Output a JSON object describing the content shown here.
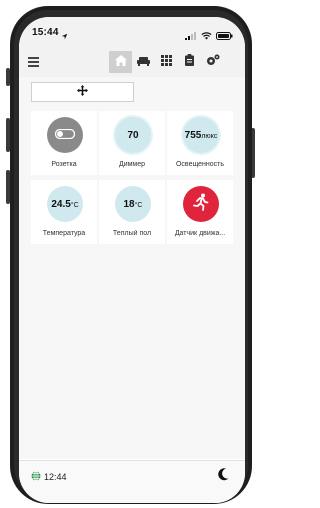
{
  "status_bar": {
    "time": "15:44"
  },
  "toolbar": {
    "icons": [
      "menu-icon",
      "home-icon",
      "sofa-icon",
      "grid-icon",
      "clipboard-icon",
      "settings-icon"
    ]
  },
  "move_box": {
    "icon": "move-arrows-icon"
  },
  "tiles": [
    {
      "label": "Розетка",
      "icon": "toggle-icon",
      "color": "#8a8a8a"
    },
    {
      "label": "Диммер",
      "value": "70",
      "color": "#cfe9ef"
    },
    {
      "label": "Освещенность",
      "value": "755",
      "unit": "люкс",
      "color": "#cfe9ef"
    },
    {
      "label": "Температура",
      "value": "24.5",
      "unit": "°C",
      "color": "#cfe9ef"
    },
    {
      "label": "Теплый пол",
      "value": "18",
      "unit": "°C",
      "color": "#cfe9ef"
    },
    {
      "label": "Датчик движа...",
      "icon": "running-person-icon",
      "color": "#e0243b"
    }
  ],
  "footer": {
    "time": "12:44",
    "globe_color": "#1e8c3a"
  }
}
